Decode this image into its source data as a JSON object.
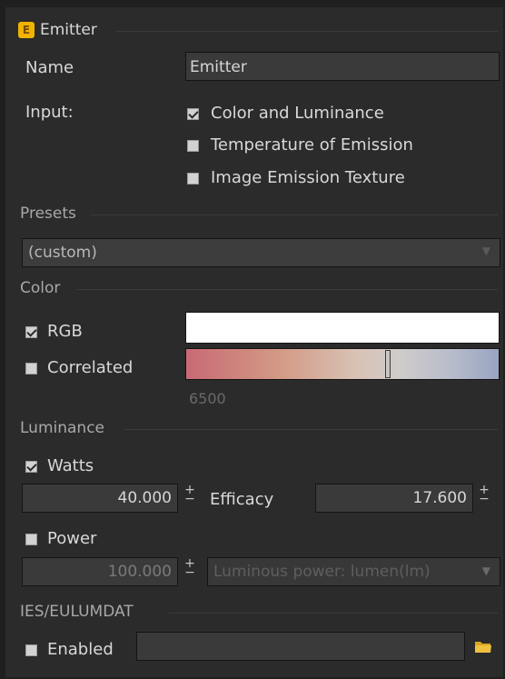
{
  "emitter": {
    "badge": "E",
    "title": "Emitter",
    "name_label": "Name",
    "name_value": "Emitter",
    "input_label": "Input:",
    "inputs": [
      {
        "label": "Color and Luminance",
        "checked": true
      },
      {
        "label": "Temperature of Emission",
        "checked": false
      },
      {
        "label": "Image Emission Texture",
        "checked": false
      }
    ]
  },
  "presets": {
    "title": "Presets",
    "selected": "(custom)"
  },
  "color": {
    "title": "Color",
    "rgb_label": "RGB",
    "rgb_checked": true,
    "rgb_swatch": "#ffffff",
    "correlated_label": "Correlated",
    "correlated_checked": false,
    "temperature": "6500"
  },
  "luminance": {
    "title": "Luminance",
    "watts_label": "Watts",
    "watts_checked": true,
    "watts_value": "40.000",
    "efficacy_label": "Efficacy",
    "efficacy_value": "17.600",
    "power_label": "Power",
    "power_checked": false,
    "power_value": "100.000",
    "power_unit": "Luminous power: lumen(lm)"
  },
  "ies": {
    "title": "IES/EULUMDAT",
    "enabled_label": "Enabled",
    "enabled_checked": false,
    "file_value": ""
  },
  "icons": {
    "badge": "emitter-badge-icon",
    "dropdown": "chevron-down-icon",
    "folder": "folder-icon"
  }
}
